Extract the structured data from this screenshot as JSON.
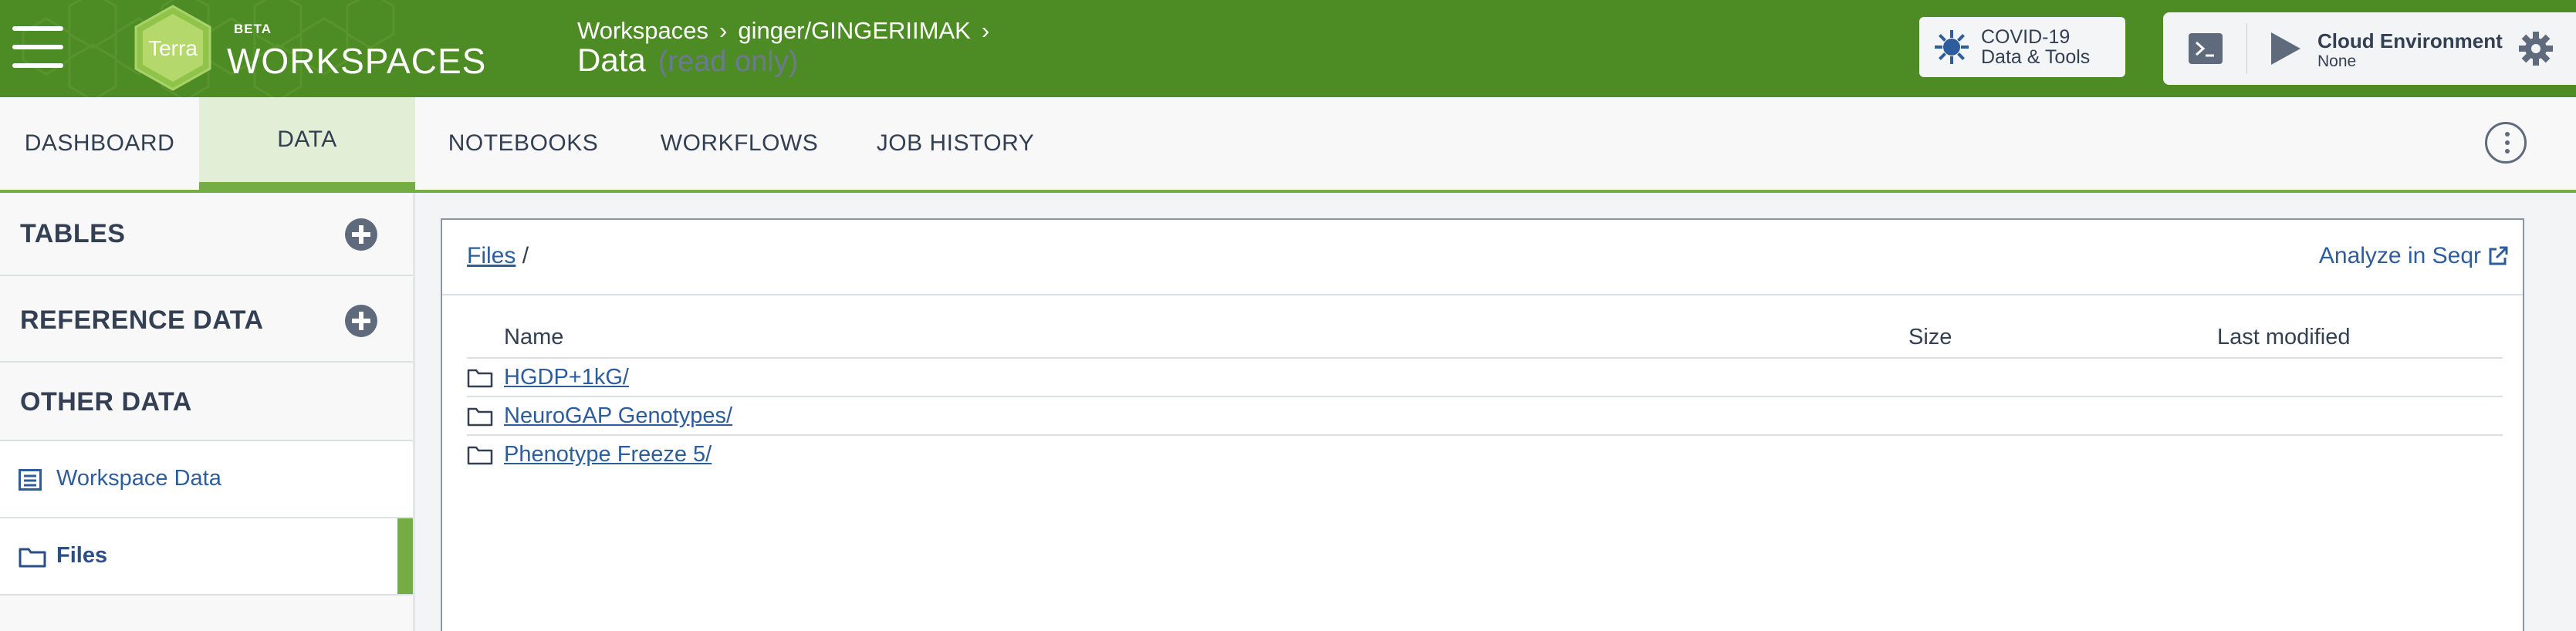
{
  "header": {
    "logo_text": "Terra",
    "beta_label": "BETA",
    "app_title": "WORKSPACES",
    "breadcrumbs": [
      "Workspaces",
      "ginger/GINGERIIMAK"
    ],
    "breadcrumb_separator": "›",
    "page_title": "Data",
    "page_title_suffix": "(read only)",
    "covid_button": {
      "line1": "COVID-19",
      "line2": "Data & Tools"
    },
    "cloud_environment": {
      "label": "Cloud Environment",
      "value": "None"
    },
    "colors": {
      "brand_green": "#4d8c24",
      "tab_accent": "#74ae43",
      "link_blue": "#2d5d9c"
    }
  },
  "tabs": [
    {
      "label": "DASHBOARD",
      "active": false
    },
    {
      "label": "DATA",
      "active": true
    },
    {
      "label": "NOTEBOOKS",
      "active": false
    },
    {
      "label": "WORKFLOWS",
      "active": false
    },
    {
      "label": "JOB HISTORY",
      "active": false
    }
  ],
  "sidebar": {
    "sections": [
      {
        "label": "TABLES",
        "icon": "plus-circle-icon"
      },
      {
        "label": "REFERENCE DATA",
        "icon": "plus-circle-icon"
      },
      {
        "label": "OTHER DATA"
      }
    ],
    "items": [
      {
        "label": "Workspace Data",
        "icon": "list-icon",
        "selected": false
      },
      {
        "label": "Files",
        "icon": "folder-icon",
        "selected": true
      }
    ]
  },
  "files": {
    "breadcrumb_root": "Files",
    "breadcrumb_sep": "/",
    "analyze_link": "Analyze in Seqr",
    "columns": [
      "Name",
      "Size",
      "Last modified"
    ],
    "rows": [
      {
        "name": "HGDP+1kG/"
      },
      {
        "name": "NeuroGAP Genotypes/"
      },
      {
        "name": "Phenotype Freeze 5/"
      }
    ]
  }
}
